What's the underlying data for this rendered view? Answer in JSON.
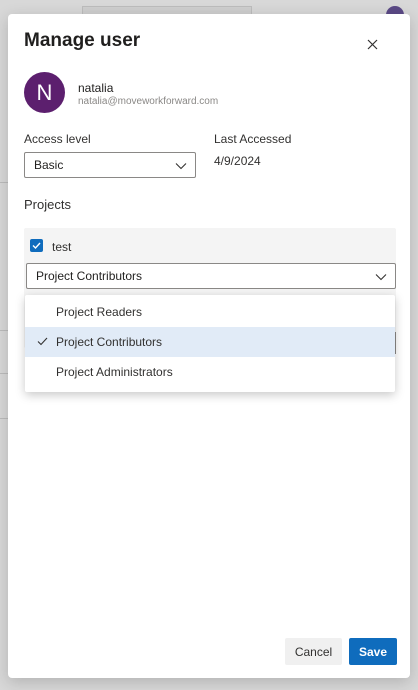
{
  "dialog": {
    "title": "Manage user",
    "close_icon": "close-icon"
  },
  "user": {
    "avatar_initial": "N",
    "avatar_color": "#5c1f6e",
    "name": "natalia",
    "email": "natalia@moveworkforward.com"
  },
  "access": {
    "label": "Access level",
    "value": "Basic"
  },
  "last_accessed": {
    "label": "Last Accessed",
    "value": "4/9/2024"
  },
  "projects": {
    "label": "Projects",
    "items": [
      {
        "name": "test",
        "checked": true,
        "role": "Project Contributors"
      }
    ],
    "role_menu": {
      "options": [
        {
          "label": "Project Readers",
          "selected": false
        },
        {
          "label": "Project Contributors",
          "selected": true
        },
        {
          "label": "Project Administrators",
          "selected": false
        }
      ]
    }
  },
  "footer": {
    "cancel_label": "Cancel",
    "save_label": "Save"
  },
  "colors": {
    "accent": "#0f6cbd",
    "selected_option_bg": "#e1ebf7"
  }
}
